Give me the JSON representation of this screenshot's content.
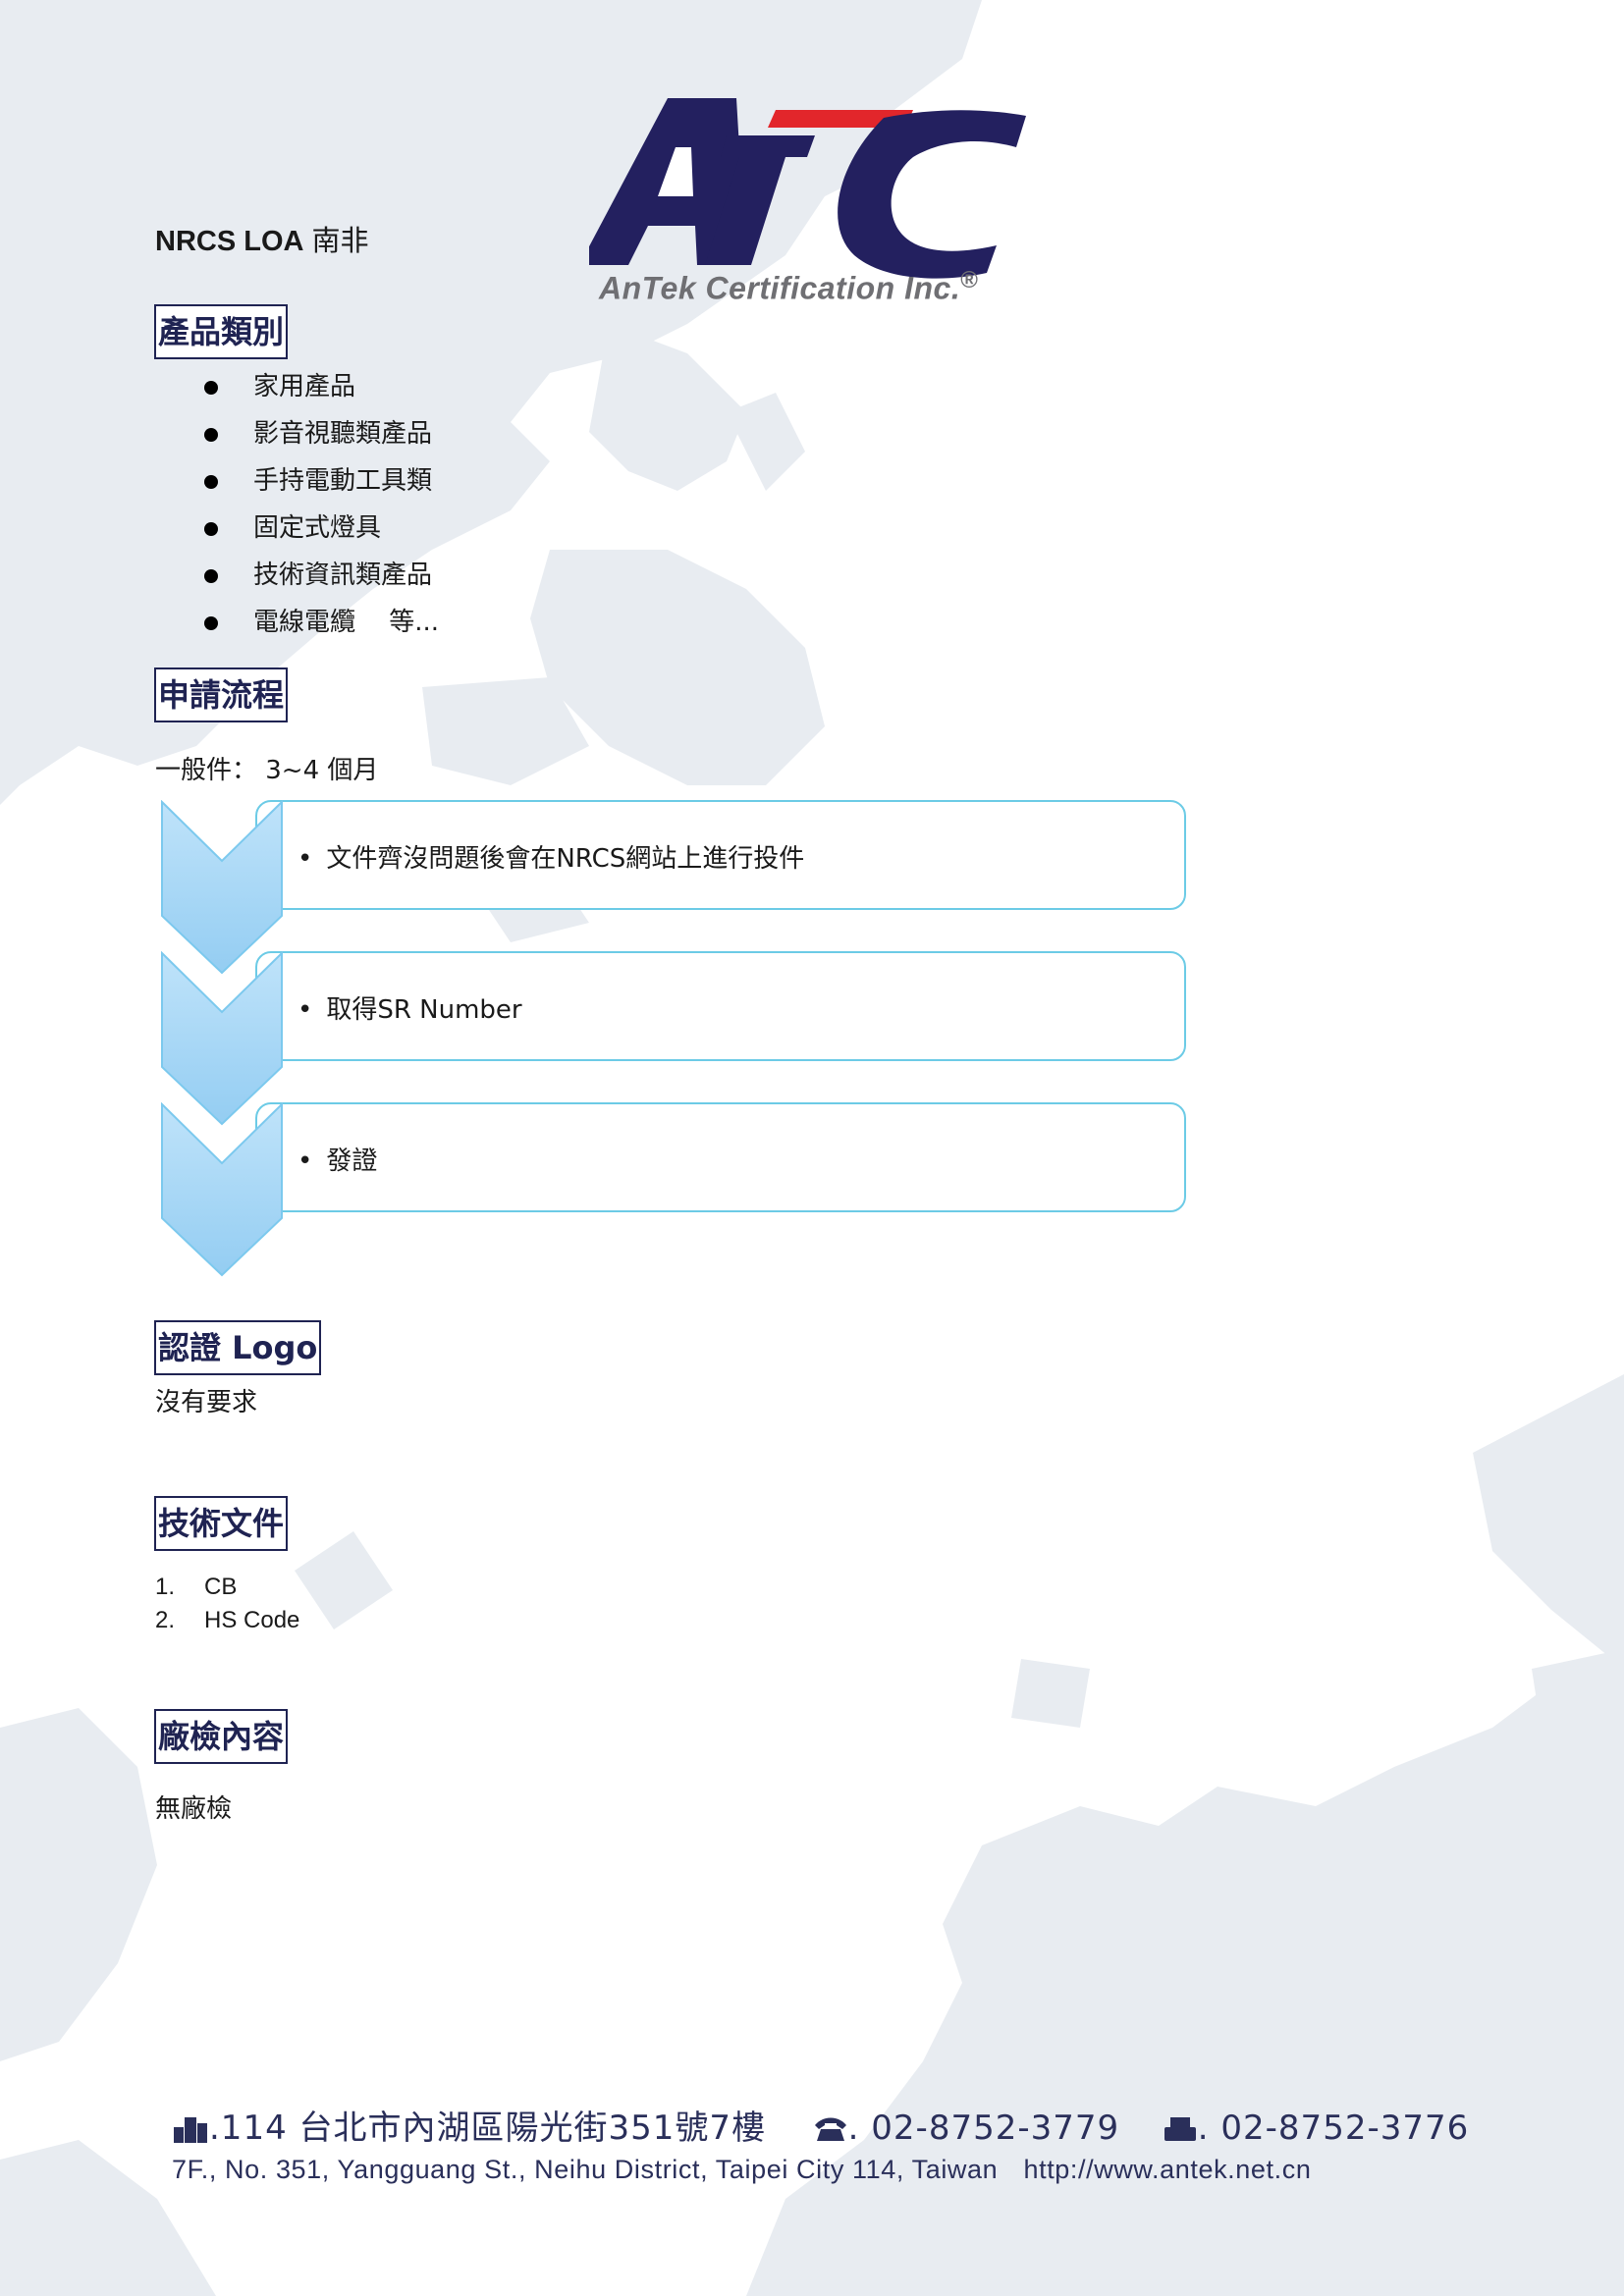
{
  "logo": {
    "mark": "ATC",
    "subtitle": "AnTek Certification Inc.",
    "registered": "®"
  },
  "title": {
    "en": "NRCS LOA",
    "zh": "南非"
  },
  "headings": {
    "product_category": "產品類別",
    "application_process": "申請流程",
    "cert_logo": "認證 Logo",
    "tech_docs": "技術文件",
    "factory_inspection": "廠檢內容"
  },
  "product_categories": [
    "家用產品",
    "影音視聽類產品",
    "手持電動工具類",
    "固定式燈具",
    "技術資訊類產品",
    "電線電纜　  等..."
  ],
  "process": {
    "duration": "一般件：  3~4 個月",
    "steps": [
      "文件齊沒問題後會在NRCS網站上進行投件",
      "取得SR Number",
      "發證"
    ]
  },
  "cert_logo_text": "沒有要求",
  "tech_docs": [
    {
      "num": "1.",
      "text": "CB"
    },
    {
      "num": "2.",
      "text": "HS Code"
    }
  ],
  "factory_inspection_text": "無廠檢",
  "footer": {
    "address_zh": ".114 台北市內湖區陽光街351號7樓",
    "phone": ". 02-8752-3779",
    "fax": ". 02-8752-3776",
    "address_en": "7F., No. 351, Yangguang St., Neihu District, Taipei City 114, Taiwan",
    "website": "http://www.antek.net.cn",
    "address_icon": "building-icon",
    "phone_icon": "telephone-icon",
    "fax_icon": "fax-icon"
  },
  "colors": {
    "brand_navy": "#23205f",
    "brand_red": "#e2262b",
    "flow_border": "#6ccbe6",
    "chevron_fill": "#a8d8f6",
    "map": "#e9edf2"
  }
}
